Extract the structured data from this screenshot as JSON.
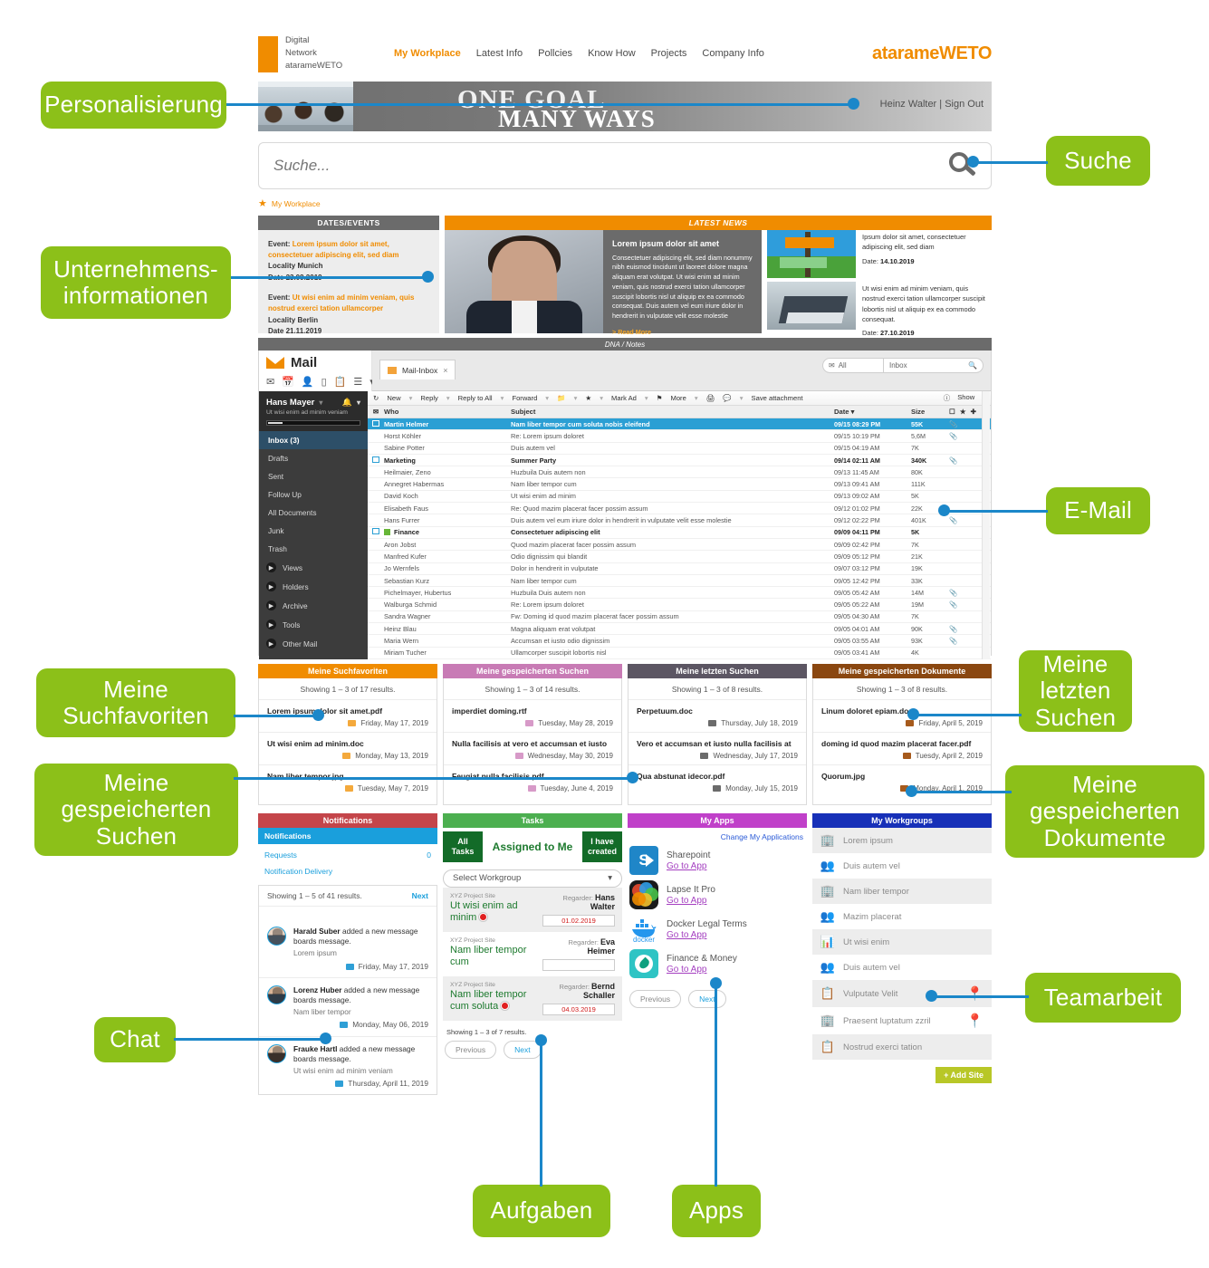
{
  "annotations": [
    {
      "id": "personalisierung",
      "label": "Personalisierung"
    },
    {
      "id": "unternehmensinformationen",
      "label": "Unternehmens-\ninformationen"
    },
    {
      "id": "suche",
      "label": "Suche"
    },
    {
      "id": "email",
      "label": "E-Mail"
    },
    {
      "id": "meine-suchfavoriten",
      "label": "Meine\nSuchfavoriten"
    },
    {
      "id": "meine-gespeicherten-suchen",
      "label": "Meine\ngespeicherten\nSuchen"
    },
    {
      "id": "meine-letzten-suchen",
      "label": "Meine\nletzten\nSuchen"
    },
    {
      "id": "meine-gespeicherten-dokumente",
      "label": "Meine\ngespeicherten\nDokumente"
    },
    {
      "id": "teamarbeit",
      "label": "Teamarbeit"
    },
    {
      "id": "chat",
      "label": "Chat"
    },
    {
      "id": "aufgaben",
      "label": "Aufgaben"
    },
    {
      "id": "apps",
      "label": "Apps"
    }
  ],
  "colors": {
    "callout_green": "#8cc019",
    "lead_blue": "#1b87c9",
    "brand_orange": "#f08c00"
  },
  "header": {
    "logo_lines": [
      "Digital",
      "Network",
      "atarameWETO"
    ],
    "nav": [
      {
        "label": "My Workplace",
        "active": true
      },
      {
        "label": "Latest Info",
        "active": false
      },
      {
        "label": "Pollcies",
        "active": false
      },
      {
        "label": "Know How",
        "active": false
      },
      {
        "label": "Projects",
        "active": false
      },
      {
        "label": "Company Info",
        "active": false
      }
    ],
    "brandmark": "atarameWETO"
  },
  "hero": {
    "line1": "ONE GOAL",
    "line2": "MANY WAYS",
    "user": "Heinz Walter | Sign Out"
  },
  "search": {
    "placeholder": "Suche...",
    "value": "",
    "icon": "search-icon"
  },
  "breadcrumb": {
    "star": "★",
    "label": "My Workplace"
  },
  "dates_events": {
    "title": "DATES/EVENTS",
    "items": [
      {
        "prefix": "Event:",
        "title": "Lorem ipsum dolor sit amet, consectetuer adipiscing elit, sed diam",
        "locality": "Locality Munich",
        "date": "Date 23.09.2019"
      },
      {
        "prefix": "Event:",
        "title": "Ut wisi enim ad minim veniam, quis nostrud exerci tation ullamcorper",
        "locality": "Locality Berlin",
        "date": "Date 21.11.2019"
      }
    ]
  },
  "latest_news": {
    "title": "LATEST NEWS",
    "lead": {
      "headline": "Lorem ipsum dolor sit amet",
      "body": "Consectetuer adipiscing elit, sed diam nonummy nibh euismod tincidunt ut laoreet dolore magna aliquam erat volutpat. Ut wisi enim ad minim veniam, quis nostrud exerci tation ullamcorper suscipit lobortis nisl ut aliquip ex ea commodo consequat. Duis autem vel eum iriure dolor in hendrerit in vulputate velit esse molestie",
      "more": "> Read More"
    },
    "items": [
      {
        "text": "Ipsum dolor sit amet, consectetuer adipiscing elit, sed diam",
        "date_label": "Date:",
        "date": "14.10.2019"
      },
      {
        "text": "Ut wisi enim ad minim veniam, quis nostrud exerci tation ullamcorper suscipit lobortis nisl ut aliquip ex ea commodo consequat.",
        "date_label": "Date:",
        "date": "27.10.2019"
      }
    ]
  },
  "dna_bar": "DNA / Notes",
  "mail": {
    "brand_title": "Mail",
    "tab": {
      "label": "Mail-Inbox",
      "close": "×"
    },
    "mini_search": {
      "scope": "All",
      "field": "Inbox"
    },
    "help_icon": "help-icon",
    "show_label": "Show",
    "sidebar": {
      "user": "Hans Mayer",
      "user_sub": "Ut wisi enim ad minim veniam",
      "items": [
        {
          "label": "Inbox (3)",
          "selected": true
        },
        {
          "label": "Drafts",
          "selected": false
        },
        {
          "label": "Sent",
          "selected": false
        },
        {
          "label": "Follow Up",
          "selected": false
        },
        {
          "label": "All Documents",
          "selected": false
        },
        {
          "label": "Junk",
          "selected": false
        },
        {
          "label": "Trash",
          "selected": false
        }
      ],
      "expandables": [
        "Views",
        "Holders",
        "Archive",
        "Tools",
        "Other Mail"
      ]
    },
    "toolbar": [
      "New",
      "Reply",
      "Reply to All",
      "Forward",
      "Mark Ad",
      "More",
      "Save attachment"
    ],
    "columns": [
      "Who",
      "Subject",
      "Date",
      "Size"
    ],
    "rows": [
      {
        "who": "Martin Helmer",
        "subject": "Nam liber tempor cum soluta nobis eleifend",
        "date": "09/15 08:29 PM",
        "size": "55K",
        "selected": true,
        "group": false,
        "attach": true
      },
      {
        "who": "Horst Köhler",
        "subject": "Re: Lorem ipsum doloret",
        "date": "09/15 10:19 PM",
        "size": "5,6M",
        "selected": false,
        "group": false,
        "attach": true
      },
      {
        "who": "Sabine Potter",
        "subject": "Duis autem vel",
        "date": "09/15 04:19 AM",
        "size": "7K",
        "selected": false,
        "group": false,
        "attach": false
      },
      {
        "who": "Marketing",
        "subject": "Summer Party",
        "date": "09/14 02:11 AM",
        "size": "340K",
        "selected": false,
        "group": true,
        "attach": true
      },
      {
        "who": "Heilmaier, Zeno",
        "subject": "Huzbuila Duis autem non",
        "date": "09/13 11:45 AM",
        "size": "80K",
        "selected": false,
        "group": false,
        "attach": false
      },
      {
        "who": "Annegret Habermas",
        "subject": "Nam liber tempor cum",
        "date": "09/13 09:41 AM",
        "size": "111K",
        "selected": false,
        "group": false,
        "attach": false
      },
      {
        "who": "David Koch",
        "subject": "Ut wisi enim ad minim",
        "date": "09/13 09:02 AM",
        "size": "5K",
        "selected": false,
        "group": false,
        "attach": false
      },
      {
        "who": "Elisabeth Faus",
        "subject": "Re: Quod mazim placerat facer possim assum",
        "date": "09/12 01:02 PM",
        "size": "22K",
        "selected": false,
        "group": false,
        "attach": false
      },
      {
        "who": "Hans Furrer",
        "subject": "Duis autem vel eum iriure dolor in hendrerit in vulputate velit esse molestie",
        "date": "09/12 02:22 PM",
        "size": "401K",
        "selected": false,
        "group": false,
        "attach": true
      },
      {
        "who": "Finance",
        "subject": "Consectetuer adipiscing elit",
        "date": "09/09 04:11 PM",
        "size": "5K",
        "selected": false,
        "group": true,
        "attach": false,
        "flag": "green"
      },
      {
        "who": "Aron Jobst",
        "subject": "Quod mazim placerat facer possim assum",
        "date": "09/09 02:42 PM",
        "size": "7K",
        "selected": false,
        "group": false,
        "attach": false
      },
      {
        "who": "Manfred Kufer",
        "subject": "Odio dignissim qui blandit",
        "date": "09/09 05:12 PM",
        "size": "21K",
        "selected": false,
        "group": false,
        "attach": false
      },
      {
        "who": "Jo Wernfels",
        "subject": "Dolor in hendrerit in vulputate",
        "date": "09/07 03:12 PM",
        "size": "19K",
        "selected": false,
        "group": false,
        "attach": false
      },
      {
        "who": "Sebastian Kurz",
        "subject": "Nam liber tempor cum",
        "date": "09/05 12:42 PM",
        "size": "33K",
        "selected": false,
        "group": false,
        "attach": false
      },
      {
        "who": "Pichelmayer, Hubertus",
        "subject": "Huzbuila Duis autem non",
        "date": "09/05 05:42 AM",
        "size": "14M",
        "selected": false,
        "group": false,
        "attach": true
      },
      {
        "who": "Walburga Schmid",
        "subject": "Re: Lorem ipsum doloret",
        "date": "09/05 05:22 AM",
        "size": "19M",
        "selected": false,
        "group": false,
        "attach": true
      },
      {
        "who": "Sandra Wagner",
        "subject": "Fw: Doming id quod mazim placerat facer possim assum",
        "date": "09/05 04:30 AM",
        "size": "7K",
        "selected": false,
        "group": false,
        "attach": false
      },
      {
        "who": "Heinz Blau",
        "subject": "Magna aliquam erat volutpat",
        "date": "09/05 04:01 AM",
        "size": "90K",
        "selected": false,
        "group": false,
        "attach": true
      },
      {
        "who": "Maria Wern",
        "subject": "Accumsan et iusto odio dignissim",
        "date": "09/05 03:55 AM",
        "size": "93K",
        "selected": false,
        "group": false,
        "attach": true
      },
      {
        "who": "Miriam Tucher",
        "subject": "Ullamcorper suscipit lobortis nisl",
        "date": "09/05 03:41 AM",
        "size": "4K",
        "selected": false,
        "group": false,
        "attach": false
      }
    ]
  },
  "search_panels": [
    {
      "title": "Meine Suchfavoriten",
      "color": "#f08c00",
      "chip": "#f4a93c",
      "count": "Showing 1 – 3 of 17 results.",
      "items": [
        {
          "name": "Lorem ipsum dolor sit amet.pdf",
          "date": "Friday, May 17, 2019"
        },
        {
          "name": "Ut wisi enim ad minim.doc",
          "date": "Monday, May 13, 2019"
        },
        {
          "name": "Nam liber tempor.jpg",
          "date": "Tuesday, May 7, 2019"
        }
      ]
    },
    {
      "title": "Meine gespeicherten Suchen",
      "color": "#c87bb5",
      "chip": "#d79ac8",
      "count": "Showing 1 – 3 of 14 results.",
      "items": [
        {
          "name": "imperdiet doming.rtf",
          "date": "Tuesday, May 28, 2019"
        },
        {
          "name": "Nulla facilisis at vero et accumsan et iusto",
          "date": "Wednesday, May 30, 2019"
        },
        {
          "name": "Feugiat nulla facilisis.pdf",
          "date": "Tuesday, June 4, 2019"
        }
      ]
    },
    {
      "title": "Meine letzten Suchen",
      "color": "#5c5663",
      "chip": "#6b6b6b",
      "count": "Showing 1 – 3 of 8 results.",
      "items": [
        {
          "name": "Perpetuum.doc",
          "date": "Thursday, July 18, 2019"
        },
        {
          "name": "Vero et accumsan et iusto nulla facilisis at",
          "date": "Wednesday, July 17, 2019"
        },
        {
          "name": "Qua abstunat idecor.pdf",
          "date": "Monday, July 15, 2019"
        }
      ]
    },
    {
      "title": "Meine gespeicherten Dokumente",
      "color": "#8a4710",
      "chip": "#a65a1c",
      "count": "Showing 1 – 3 of 8 results.",
      "items": [
        {
          "name": "Linum doloret epiam.doc",
          "date": "Friday, April 5, 2019"
        },
        {
          "name": "doming id quod mazim placerat facer.pdf",
          "date": "Tuesdy, April 2, 2019"
        },
        {
          "name": "Quorum.jpg",
          "date": "Monday, April 1, 2019"
        }
      ]
    }
  ],
  "notifications": {
    "title": "Notifications",
    "color": "#c4454a",
    "tab": "Notifications",
    "requests_label": "Requests",
    "requests_count": "0",
    "delivery_link": "Notification Delivery",
    "count": "Showing 1 – 5 of 41 results.",
    "next": "Next",
    "items": [
      {
        "actor": "Harald Suber",
        "action": "added a new message boards message.",
        "sub": "Lorem ipsum",
        "date": "Friday, May 17, 2019"
      },
      {
        "actor": "Lorenz Huber",
        "action": "added a new message boards message.",
        "sub": "Nam liber tempor",
        "date": "Monday, May 06, 2019"
      },
      {
        "actor": "Frauke Hartl",
        "action": "added a new message boards message.",
        "sub": "Ut wisi enim ad minim veniam",
        "date": "Thursday, April 11, 2019"
      }
    ]
  },
  "tasks": {
    "title": "Tasks",
    "color": "#4caf50",
    "tabs": [
      {
        "label": "All\nTasks",
        "style": "dark"
      },
      {
        "label": "Assigned to\nMe",
        "style": "plain"
      },
      {
        "label": "I have\ncreated",
        "style": "dark"
      }
    ],
    "select_label": "Select Workgroup",
    "items": [
      {
        "site": "XYZ Project Site",
        "title": "Ut wisi enim ad minim",
        "flag": true,
        "regarder_label": "Regarder:",
        "regarder": "Hans Walter",
        "date": "01.02.2019"
      },
      {
        "site": "XYZ Project Site",
        "title": "Nam liber tempor cum",
        "flag": false,
        "regarder_label": "Regarder:",
        "regarder": "Eva Heimer",
        "date": ""
      },
      {
        "site": "XYZ Project Site",
        "title": "Nam liber tempor cum soluta",
        "flag": true,
        "regarder_label": "Regarder:",
        "regarder": "Bernd Schaller",
        "date": "04.03.2019"
      }
    ],
    "count": "Showing 1 – 3 of 7 results.",
    "prev": "Previous",
    "next": "Next"
  },
  "my_apps": {
    "title": "My Apps",
    "color": "#c040c9",
    "change_link": "Change My Applications",
    "items": [
      {
        "name": "Sharepoint",
        "link": "Go to App",
        "icon": "sharepoint-icon"
      },
      {
        "name": "Lapse It Pro",
        "link": "Go to App",
        "icon": "lapse-it-pro-icon"
      },
      {
        "name": "Docker Legal Terms",
        "link": "Go to App",
        "icon": "docker-icon"
      },
      {
        "name": "Finance & Money",
        "link": "Go to App",
        "icon": "finance-money-icon"
      }
    ],
    "prev": "Previous",
    "next": "Next"
  },
  "workgroups": {
    "title": "My Workgroups",
    "color": "#1730b8",
    "items": [
      {
        "label": "Lorem ipsum",
        "icon": "building-icon",
        "pin": false
      },
      {
        "label": "Duis autem vel",
        "icon": "meeting-icon",
        "pin": false
      },
      {
        "label": "Nam liber tempor",
        "icon": "building-icon",
        "pin": false
      },
      {
        "label": "Mazim placerat",
        "icon": "meeting-icon",
        "pin": false
      },
      {
        "label": "Ut wisi enim",
        "icon": "presentation-icon",
        "pin": false
      },
      {
        "label": "Duis autem vel",
        "icon": "meeting-icon",
        "pin": false
      },
      {
        "label": "Vulputate Velit",
        "icon": "clipboard-icon",
        "pin": true
      },
      {
        "label": "Praesent luptatum zzril",
        "icon": "building-icon",
        "pin": true
      },
      {
        "label": "Nostrud exerci tation",
        "icon": "clipboard-icon",
        "pin": false
      }
    ],
    "add_site": "+ Add Site"
  }
}
